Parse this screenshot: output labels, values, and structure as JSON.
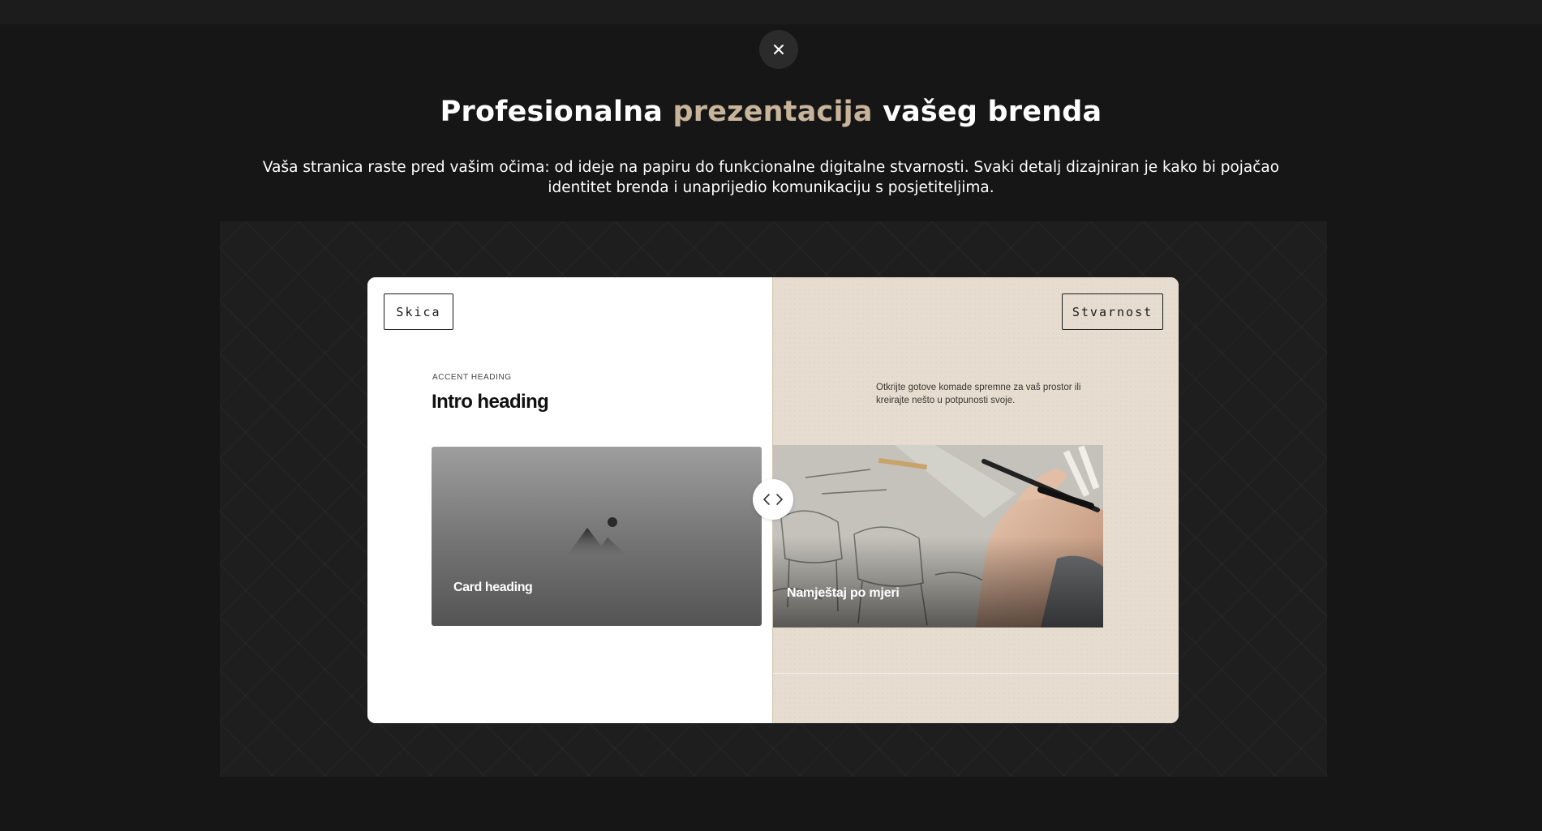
{
  "modal": {
    "close_icon": "close-icon",
    "title_part1": "Profesionalna",
    "title_accent": "prezentacija",
    "title_part2": "vašeg brenda",
    "accent_color": "#c8b49a",
    "description": "Vaša stranica raste pred vašim očima: od ideje na papiru do funkcionalne digitalne stvarnosti. Svaki detalj dizajniran je kako bi pojačao identitet brenda i unaprijedio komunikaciju s posjetiteljima."
  },
  "comparison": {
    "left_label": "Skica",
    "right_label": "Stvarnost",
    "handle_icon": "chevron-left-right-icon",
    "sketch": {
      "accent_heading": "ACCENT HEADING",
      "intro_heading": "Intro heading",
      "card_heading": "Card heading",
      "image_icon": "image-placeholder-icon"
    },
    "reality": {
      "intro_text": "Otkrijte gotove komade spremne za vaš prostor ili kreirajte nešto u potpunosti svoje.",
      "card_heading": "Namještaj po mjeri"
    }
  }
}
